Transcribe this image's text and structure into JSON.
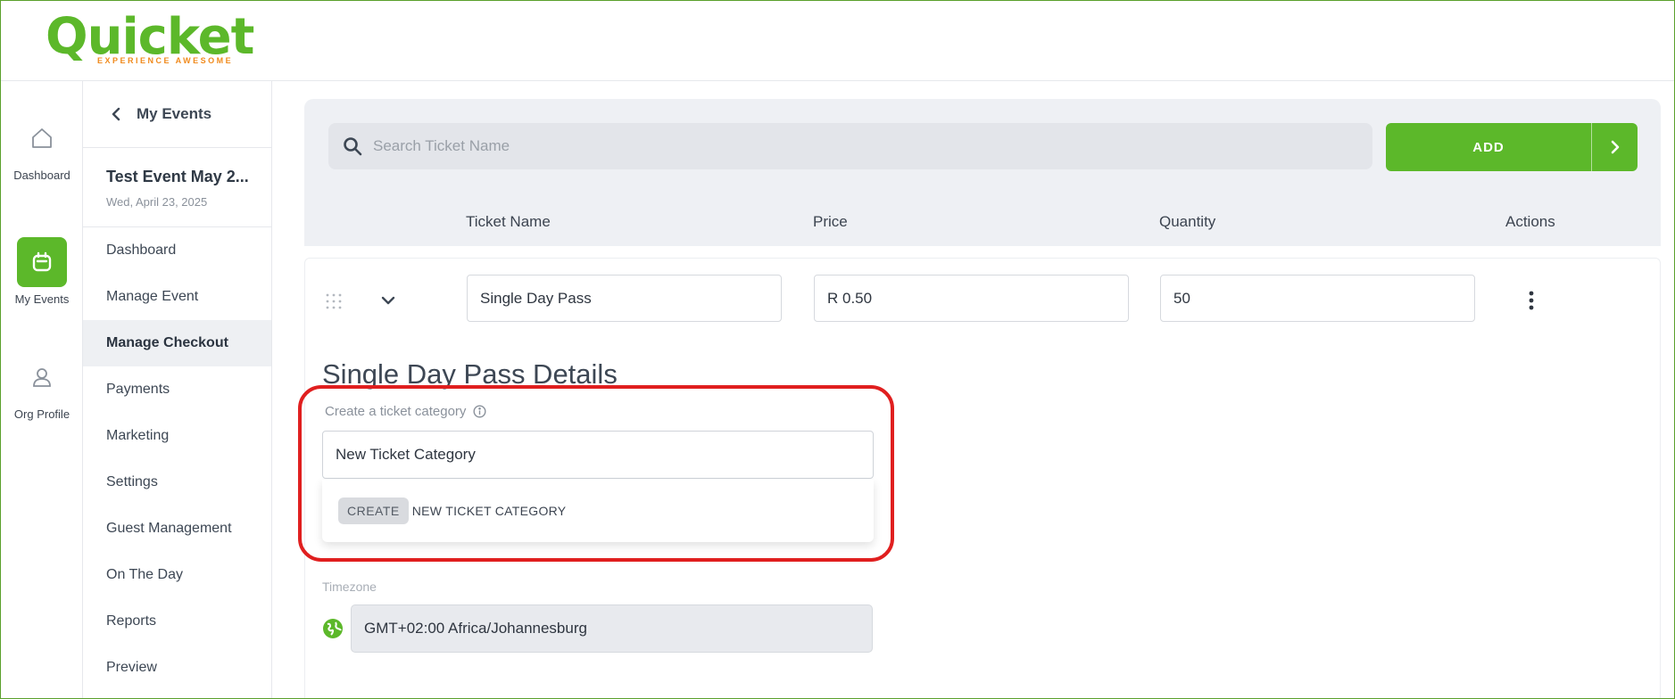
{
  "brand": {
    "name": "Quicket",
    "tagline": "EXPERIENCE AWESOME",
    "primary_color": "#5cb82a",
    "accent_color": "#f08a1c"
  },
  "rail": {
    "items": [
      {
        "label": "Dashboard",
        "icon": "home-icon"
      },
      {
        "label": "My Events",
        "icon": "calendar-icon",
        "active": true
      },
      {
        "label": "Org Profile",
        "icon": "person-icon"
      }
    ]
  },
  "subnav": {
    "back_label": "My Events",
    "event_name": "Test Event May 2...",
    "event_date": "Wed, April 23, 2025",
    "items": [
      {
        "label": "Dashboard"
      },
      {
        "label": "Manage Event"
      },
      {
        "label": "Manage Checkout",
        "active": true
      },
      {
        "label": "Payments"
      },
      {
        "label": "Marketing"
      },
      {
        "label": "Settings"
      },
      {
        "label": "Guest Management"
      },
      {
        "label": "On The Day"
      },
      {
        "label": "Reports"
      },
      {
        "label": "Preview"
      }
    ]
  },
  "toolbar": {
    "search_placeholder": "Search Ticket Name",
    "search_value": "",
    "add_label": "ADD"
  },
  "table": {
    "columns": [
      "Ticket Name",
      "Price",
      "Quantity",
      "Actions"
    ]
  },
  "ticket": {
    "name": "Single Day Pass",
    "price": "R 0.50",
    "quantity": "50",
    "details_title": "Single Day Pass Details"
  },
  "category": {
    "label": "Create a ticket category",
    "input_value": "New Ticket Category",
    "create_chip": "CREATE",
    "create_text": "NEW TICKET CATEGORY"
  },
  "timezone": {
    "label": "Timezone",
    "value": "GMT+02:00 Africa/Johannesburg"
  },
  "annotation": {
    "highlight_color": "#e01f1f"
  }
}
